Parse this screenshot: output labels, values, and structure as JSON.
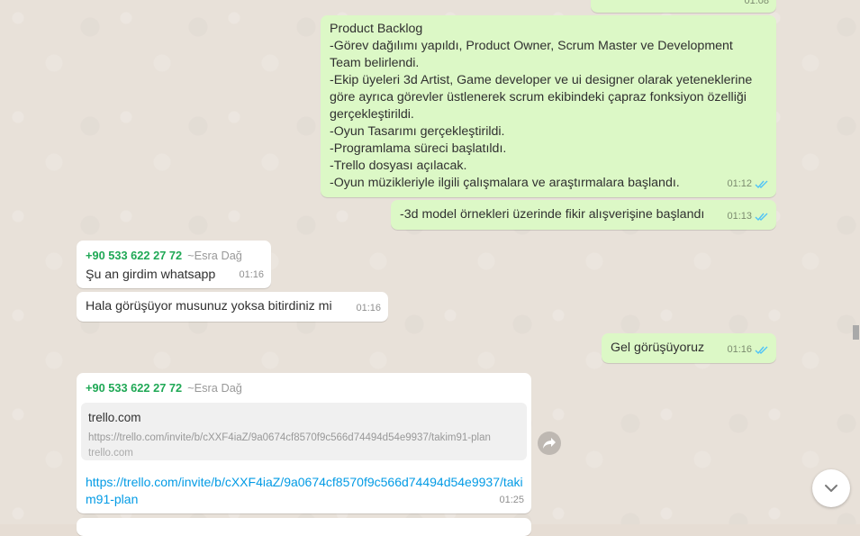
{
  "messages": {
    "top_partial": {
      "time": "01:08"
    },
    "backlog": {
      "text": "Product Backlog\n-Görev dağılımı yapıldı, Product Owner, Scrum Master ve Development Team belirlendi.\n-Ekip üyeleri 3d Artist, Game developer ve ui designer olarak yeteneklerine göre ayrıca görevler üstlenerek scrum ekibindeki çapraz fonksiyon özelliği gerçekleştirildi.\n-Oyun Tasarımı gerçekleştirildi.\n-Programlama süreci başlatıldı.\n-Trello dosyası açılacak.\n-Oyun müzikleriyle ilgili çalışmalara ve araştırmalara başlandı.",
      "time": "01:12"
    },
    "model": {
      "text": "-3d model örnekleri üzerinde fikir alışverişine başlandı",
      "time": "01:13"
    },
    "whatsapp": {
      "sender_number": "+90 533 622 27 72",
      "sender_name": "~Esra Dağ",
      "text": "Şu an girdim whatsapp",
      "time": "01:16"
    },
    "hala": {
      "text": "Hala görüşüyor musunuz yoksa bitirdiniz mi",
      "time": "01:16"
    },
    "gel": {
      "text": "Gel görüşüyoruz",
      "time": "01:16"
    },
    "trello": {
      "sender_number": "+90 533 622 27 72",
      "sender_name": "~Esra Dağ",
      "preview_title": "trello.com",
      "preview_url": "https://trello.com/invite/b/cXXF4iaZ/9a0674cf8570f9c566d74494d54e9937/takim91-plan",
      "preview_domain": "trello.com",
      "link": "https://trello.com/invite/b/cXXF4iaZ/9a0674cf8570f9c566d74494d54e9937/takim91-plan",
      "time": "01:25"
    }
  },
  "icons": {
    "read_receipt": "double-check-icon",
    "forward": "forward-icon",
    "scroll_down": "chevron-down-icon"
  },
  "colors": {
    "outgoing_bubble": "#dcf8c6",
    "incoming_bubble": "#ffffff",
    "sender_number": "#1fa855",
    "link": "#039be5",
    "read_tick": "#4fc3f7"
  }
}
